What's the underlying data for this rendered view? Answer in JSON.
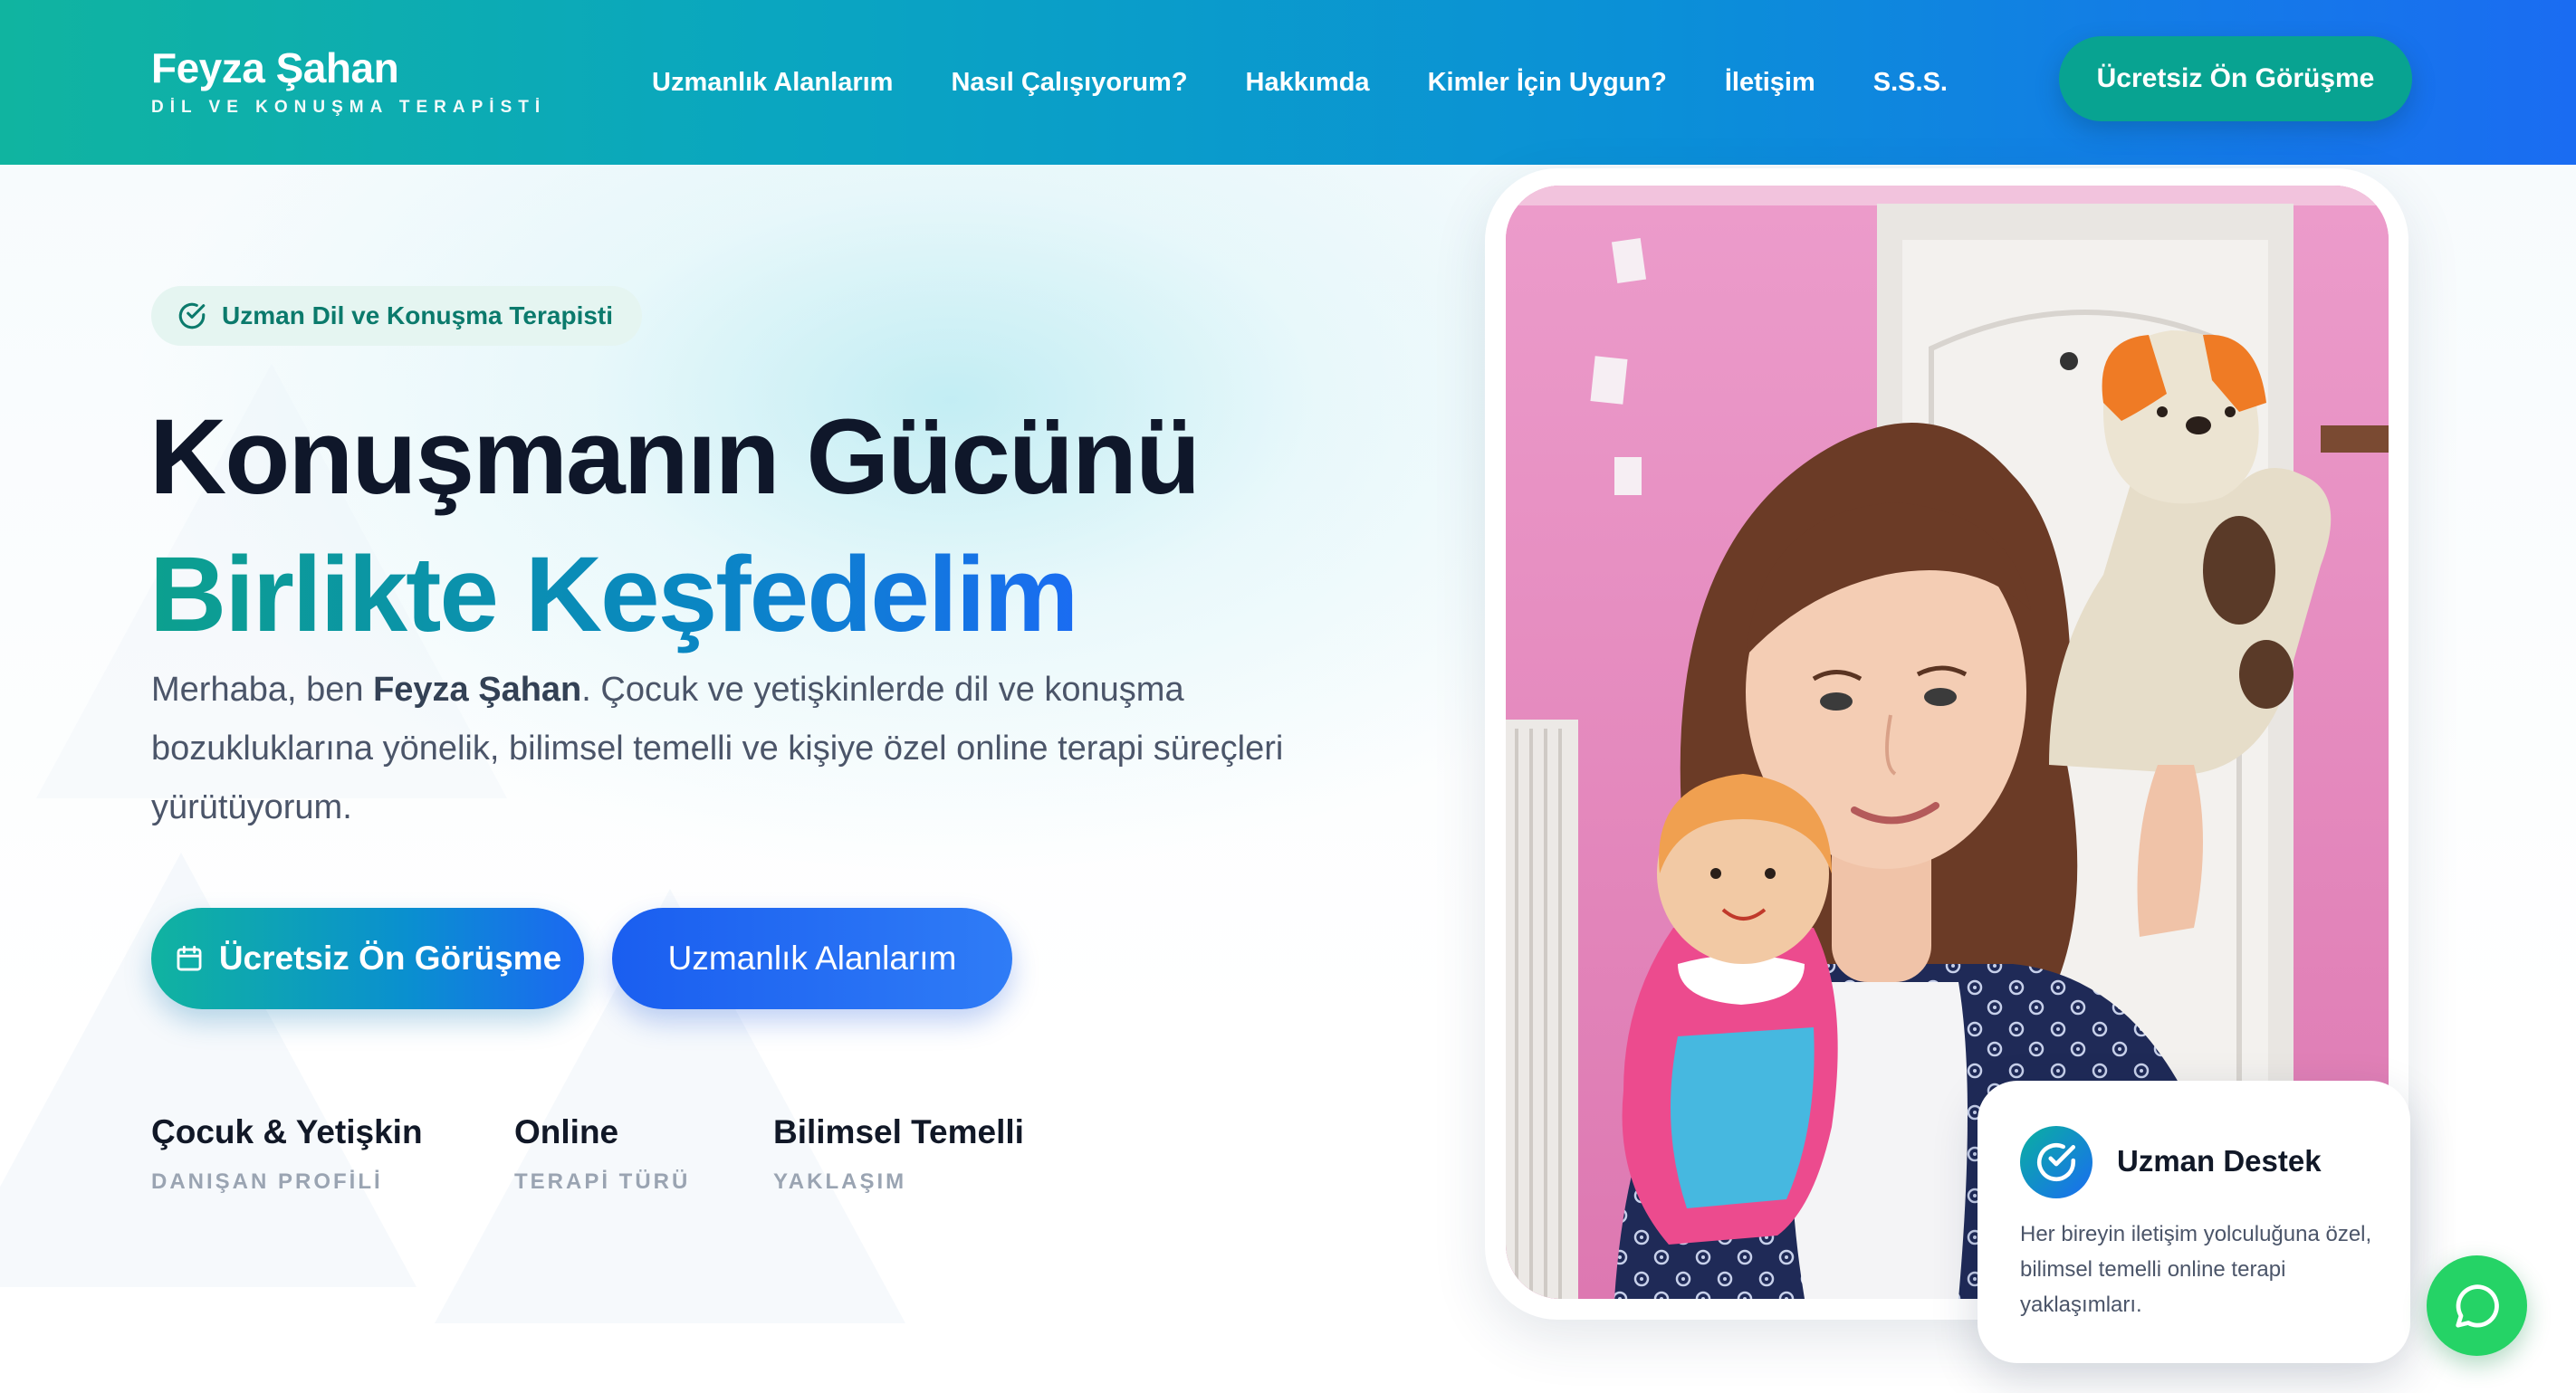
{
  "brand": {
    "name": "Feyza Şahan",
    "subtitle": "DİL VE KONUŞMA TERAPİSTİ"
  },
  "nav": {
    "items": [
      {
        "label": "Uzmanlık Alanlarım"
      },
      {
        "label": "Nasıl Çalışıyorum?"
      },
      {
        "label": "Hakkımda"
      },
      {
        "label": "Kimler İçin Uygun?"
      },
      {
        "label": "İletişim"
      },
      {
        "label": "S.S.S."
      }
    ],
    "cta_label": "Ücretsiz Ön Görüşme"
  },
  "hero": {
    "badge_icon": "check-circle-icon",
    "badge_label": "Uzman Dil ve Konuşma Terapisti",
    "title_line1": "Konuşmanın Gücünü",
    "title_line2": "Birlikte Keşfedelim",
    "intro_prefix": "Merhaba, ben ",
    "intro_name": "Feyza Şahan",
    "intro_suffix": ". Çocuk ve yetişkinlerde dil ve konuşma bozukluklarına yönelik, bilimsel temelli ve kişiye özel online terapi süreçleri yürütüyorum.",
    "primary_button_icon": "calendar-icon",
    "primary_button_label": "Ücretsiz Ön Görüşme",
    "secondary_button_label": "Uzmanlık Alanlarım",
    "stats": [
      {
        "title": "Çocuk & Yetişkin",
        "subtitle": "DANIŞAN PROFİLİ"
      },
      {
        "title": "Online",
        "subtitle": "TERAPİ TÜRÜ"
      },
      {
        "title": "Bilimsel Temelli",
        "subtitle": "YAKLAŞIM"
      }
    ]
  },
  "info_card": {
    "icon": "check-circle-icon",
    "title": "Uzman Destek",
    "text": "Her bireyin iletişim yolculuğuna özel, bilimsel temelli online terapi yaklaşımları."
  },
  "floating": {
    "whatsapp_icon": "whatsapp-icon"
  },
  "colors": {
    "teal": "#10b4a0",
    "blue": "#1a6cf2",
    "whatsapp": "#25d366"
  }
}
